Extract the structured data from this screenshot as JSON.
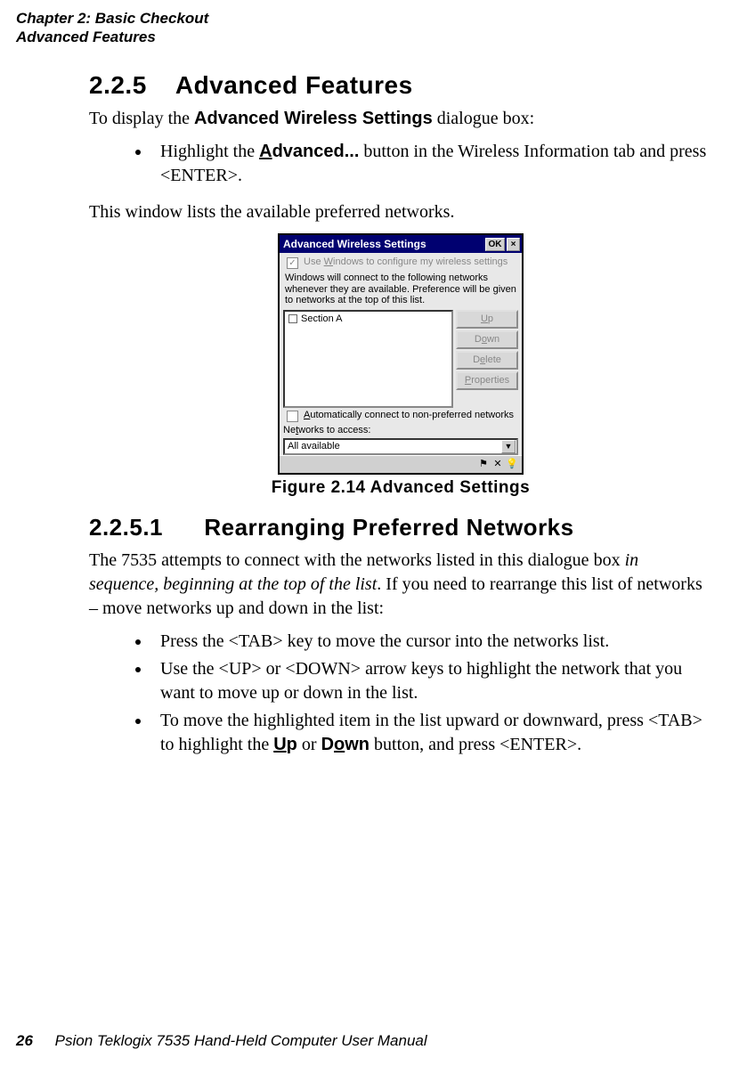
{
  "header": {
    "chapter": "Chapter  2:  Basic Checkout",
    "section": "Advanced Features"
  },
  "section225": {
    "number": "2.2.5",
    "title": "Advanced  Features",
    "intro_prefix": "To display the ",
    "intro_bold": "Advanced Wireless  Settings",
    "intro_suffix": " dialogue box:",
    "bullet1_prefix": "Highlight the ",
    "bullet1_bold_pre": "A",
    "bullet1_bold_rest": "dvanced...",
    "bullet1_suffix": " button in the Wireless Information tab and press <ENTER>.",
    "para2": "This window lists the available preferred networks."
  },
  "figure": {
    "caption": "Figure  2.14  Advanced  Settings"
  },
  "dialog": {
    "title": "Advanced Wireless Settings",
    "ok": "OK",
    "close": "×",
    "chk1_pre": "Use ",
    "chk1_u": "W",
    "chk1_post": "indows to configure my wireless settings",
    "info": "Windows will connect to the following networks whenever they are available. Preference will be given to networks at the top of this list.",
    "list_item1": "Section A",
    "buttons": {
      "up_u": "U",
      "up_rest": "p",
      "down_pre": "D",
      "down_u": "o",
      "down_post": "wn",
      "delete_pre": "D",
      "delete_u": "e",
      "delete_post": "lete",
      "props_u": "P",
      "props_rest": "roperties"
    },
    "chk2_u": "A",
    "chk2_post": "utomatically connect to non-preferred networks",
    "access_pre": "Ne",
    "access_u": "t",
    "access_post": "works to access:",
    "dropdown_value": "All available"
  },
  "section2251": {
    "number": "2.2.5.1",
    "title": "Rearranging  Preferred  Networks",
    "para_a": "The 7535 attempts to connect with the networks listed in this dialogue box ",
    "para_i": "in sequence, beginning at the top of the list",
    "para_b": ". If you need to rearrange this list of networks – move networks up and down in the list:",
    "bullet1": "Press the <TAB> key to move the cursor into the networks list.",
    "bullet2": "Use the <UP> or <DOWN> arrow keys to highlight the network that you want to move up or down in the list.",
    "bullet3_a": "To move the highlighted item in the list upward or downward, press <TAB> to highlight the ",
    "bullet3_up_u": "U",
    "bullet3_up_rest": "p",
    "bullet3_mid": " or ",
    "bullet3_down_pre": "D",
    "bullet3_down_u": "o",
    "bullet3_down_post": "wn",
    "bullet3_b": " button, and press <ENTER>."
  },
  "footer": {
    "page": "26",
    "title": "Psion Teklogix 7535 Hand-Held Computer User Manual"
  }
}
